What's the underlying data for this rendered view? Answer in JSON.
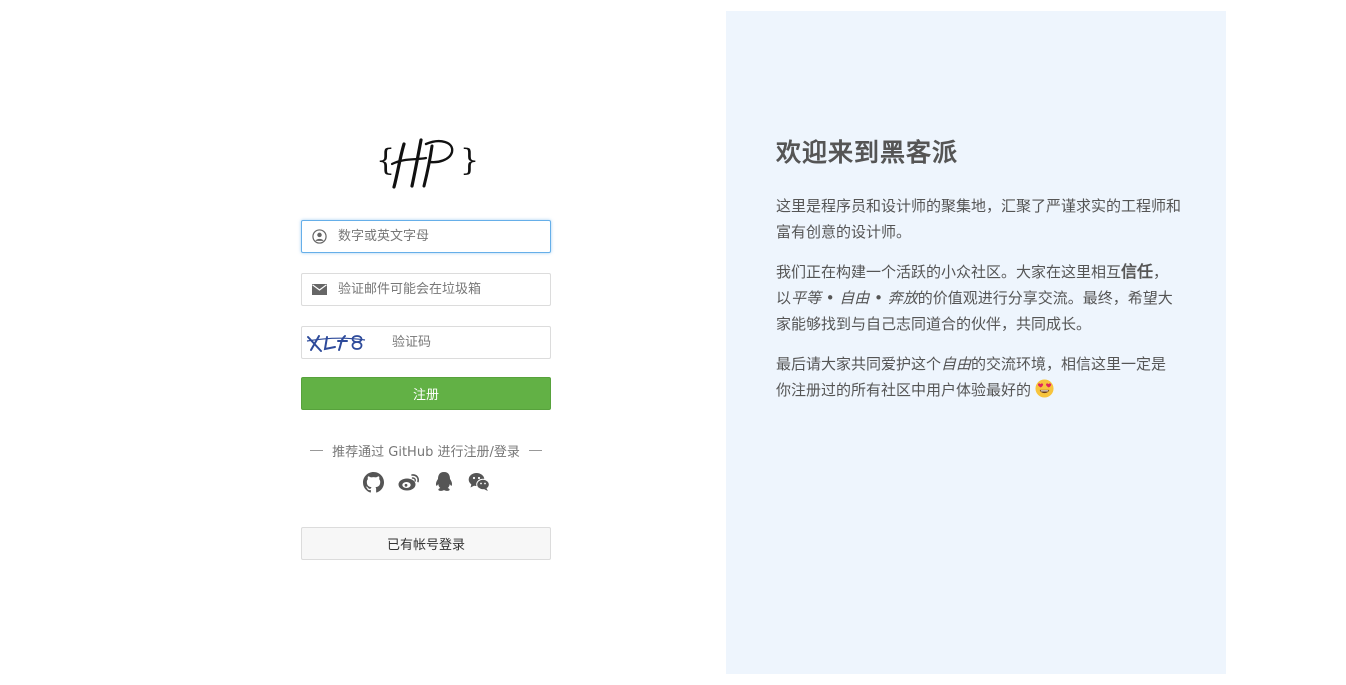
{
  "logo": {
    "text": "{HP}"
  },
  "form": {
    "username_placeholder": "数字或英文字母",
    "email_placeholder": "验证邮件可能会在垃圾箱",
    "captcha_image_text": "XLf8",
    "captcha_placeholder": "验证码",
    "register_label": "注册",
    "third_party_hint": "推荐通过 GitHub 进行注册/登录",
    "login_label": "已有帐号登录"
  },
  "social": [
    "github-icon",
    "weibo-icon",
    "qq-icon",
    "wechat-icon"
  ],
  "welcome": {
    "title": "欢迎来到黑客派",
    "p1": "这里是程序员和设计师的聚集地，汇聚了严谨求实的工程师和富有创意的设计师。",
    "p2_a": "我们正在构建一个活跃的小众社区。大家在这里相互",
    "p2_trust": "信任",
    "p2_b": "，以",
    "p2_values": "平等 • 自由 • 奔放",
    "p2_c": "的价值观进行分享交流。最终，希望大家能够找到与自己志同道合的伙伴，共同成长。",
    "p3_a": "最后请大家共同爱护这个",
    "p3_free": "自由",
    "p3_b": "的交流环境，相信这里一定是你注册过的所有社区中用户体验最好的"
  },
  "colors": {
    "primary_button": "#62b145",
    "panel_background": "#eef5fd",
    "focus_border": "#66afe9"
  }
}
